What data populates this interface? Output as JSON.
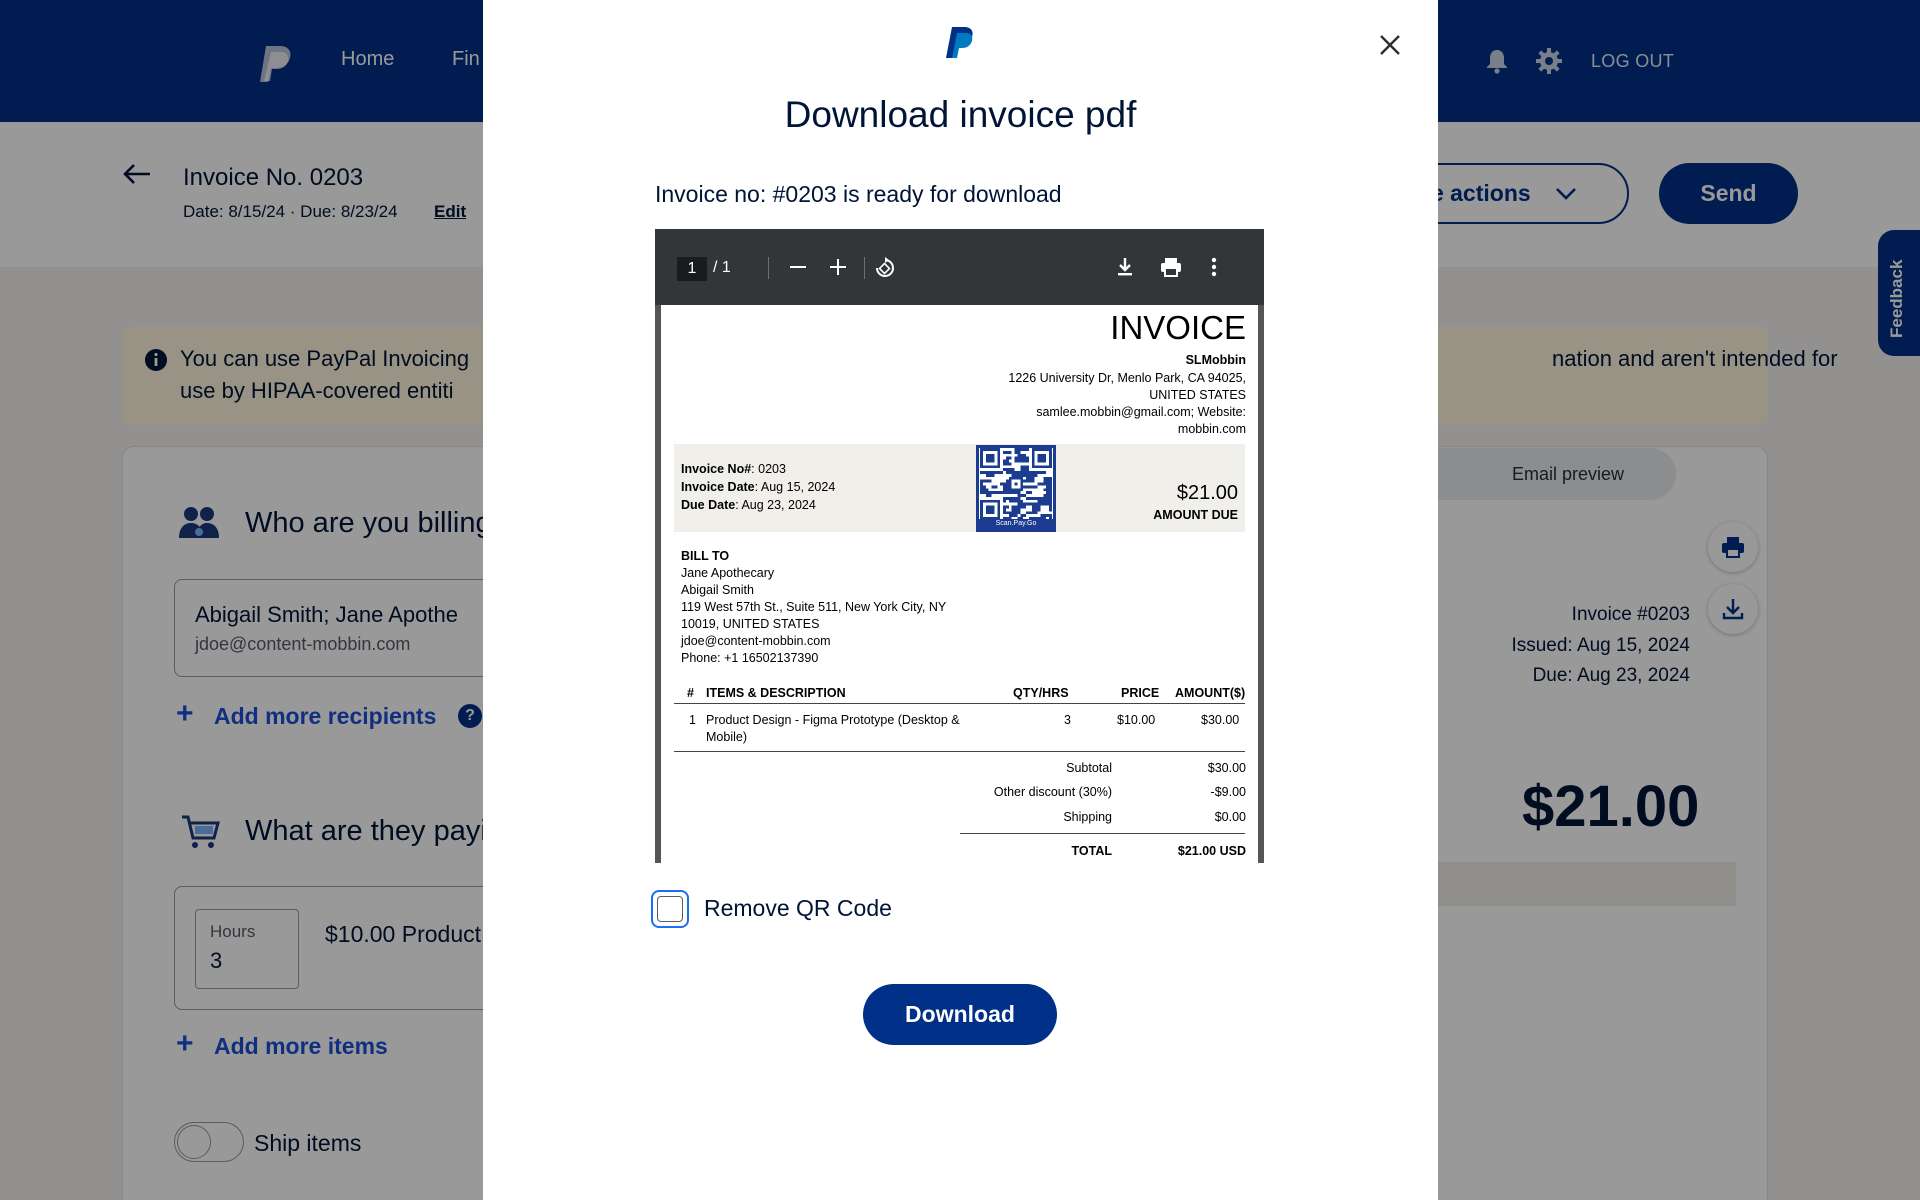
{
  "nav": {
    "links": [
      "Home",
      "Fin"
    ],
    "logout": "LOG OUT"
  },
  "invoice_header": {
    "title": "Invoice No. 0203",
    "dates": "Date: 8/15/24 · Due: 8/23/24",
    "edit": "Edit",
    "more_actions": "re actions",
    "send": "Send"
  },
  "feedback": "Feedback",
  "banner": {
    "line1_left": "You can use PayPal Invoicing",
    "line1_right": "nation and aren't intended for",
    "line2_left": "use by HIPAA-covered entiti"
  },
  "form": {
    "billing_title": "Who are you billing",
    "recipient_name": "Abigail Smith; Jane Apothe",
    "recipient_email": "jdoe@content-mobbin.com",
    "add_recipients": "Add more recipients",
    "help": "?",
    "paying_title": "What are they payi",
    "hours_label": "Hours",
    "hours_value": "3",
    "item_desc": "$10.00 Product",
    "add_items": "Add more items",
    "ship_items": "Ship items"
  },
  "preview": {
    "tab": "Email preview",
    "invoice_no": "Invoice #0203",
    "issued": "Issued: Aug 15, 2024",
    "due": "Due: Aug 23, 2024",
    "amount": "$21.00"
  },
  "modal": {
    "title": "Download invoice pdf",
    "subtitle": "Invoice no: #0203 is ready for download",
    "remove_qr": "Remove QR Code",
    "remove_qr_checked": false,
    "download": "Download"
  },
  "pdf_viewer": {
    "page_current": "1",
    "page_total": "/  1"
  },
  "pdf": {
    "heading": "INVOICE",
    "company": "SLMobbin",
    "address1": "1226 University Dr, Menlo Park, CA 94025,",
    "address2": "UNITED STATES",
    "contact1": "samlee.mobbin@gmail.com; Website:",
    "contact2": "mobbin.com",
    "meta": {
      "no_label": "Invoice No#",
      "no_value": ": 0203",
      "date_label": "Invoice Date",
      "date_value": ": Aug 15, 2024",
      "due_label": "Due Date",
      "due_value": ": Aug 23, 2024"
    },
    "qr_caption": "Scan.Pay.Go",
    "amount_due": "$21.00",
    "amount_due_label": "AMOUNT DUE",
    "bill_to": {
      "label": "BILL TO",
      "lines": [
        "Jane Apothecary",
        "Abigail Smith",
        "119 West 57th St., Suite 511, New York City, NY",
        "10019, UNITED STATES",
        "jdoe@content-mobbin.com",
        "Phone: +1 16502137390"
      ]
    },
    "table": {
      "headers": [
        "#",
        "ITEMS & DESCRIPTION",
        "QTY/HRS",
        "PRICE",
        "AMOUNT($)"
      ],
      "rows": [
        {
          "num": "1",
          "desc1": "Product Design - Figma Prototype (Desktop &",
          "desc2": "Mobile)",
          "qty": "3",
          "price": "$10.00",
          "amount": "$30.00"
        }
      ]
    },
    "totals": {
      "subtotal_label": "Subtotal",
      "subtotal": "$30.00",
      "discount_label": "Other discount (30%)",
      "discount": "-$9.00",
      "shipping_label": "Shipping",
      "shipping": "$0.00",
      "total_label": "TOTAL",
      "total": "$21.00 USD"
    }
  },
  "colors": {
    "nav_blue": "#003087",
    "link_blue": "#1d4fd8",
    "banner_bg": "#fef5dd",
    "qr_blue": "#1b3c8f"
  }
}
